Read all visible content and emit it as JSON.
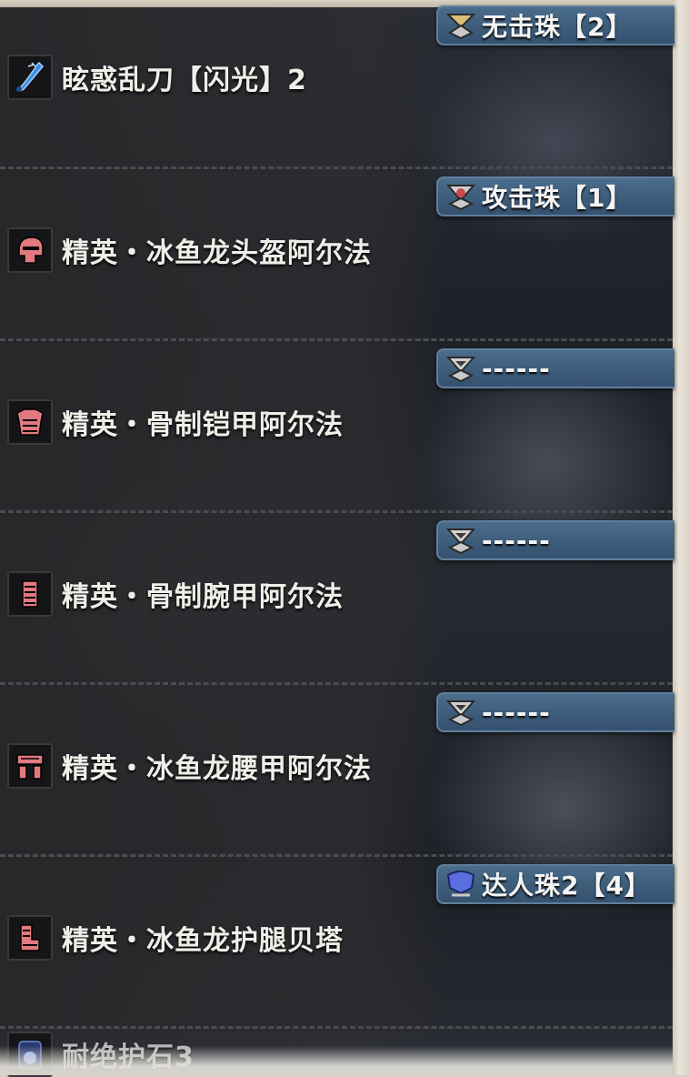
{
  "equipment": [
    {
      "name": "眩惑乱刀【闪光】2",
      "icon": "sword-icon",
      "slot": "无击珠【2】",
      "gem": "gold-gem-icon"
    },
    {
      "name": "精英・冰鱼龙头盔阿尔法",
      "icon": "helmet-icon",
      "slot": "攻击珠【1】",
      "gem": "red-gem-icon"
    },
    {
      "name": "精英・骨制铠甲阿尔法",
      "icon": "chest-armor-icon",
      "slot": "------",
      "gem": "empty-gem-icon"
    },
    {
      "name": "精英・骨制腕甲阿尔法",
      "icon": "gauntlet-icon",
      "slot": "------",
      "gem": "empty-gem-icon"
    },
    {
      "name": "精英・冰鱼龙腰甲阿尔法",
      "icon": "waist-armor-icon",
      "slot": "------",
      "gem": "empty-gem-icon"
    },
    {
      "name": "精英・冰鱼龙护腿贝塔",
      "icon": "leg-armor-icon",
      "slot": "达人珠2【4】",
      "gem": "blue-gem-icon"
    }
  ],
  "charm": {
    "name": "耐绝护石3",
    "icon": "charm-icon"
  },
  "colors": {
    "slot_bar": "#3c5b78",
    "text": "#f0eee8",
    "armor_icon": "#e07a80",
    "gold_gem": "#d9c07a",
    "red_gem": "#c84a4a",
    "blue_gem": "#5a6ee0"
  }
}
